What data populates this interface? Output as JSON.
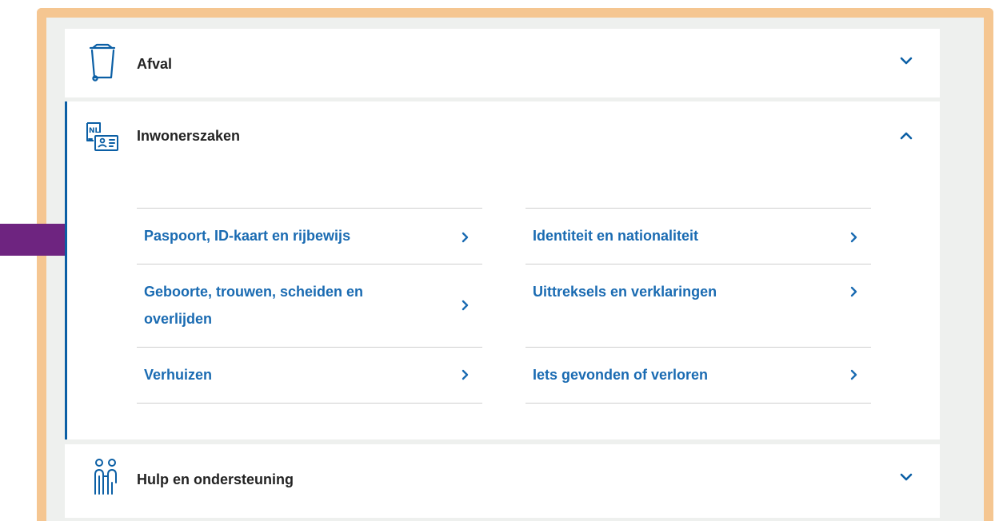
{
  "colors": {
    "accent_blue": "#0b5fa5",
    "link_blue": "#1a6bb2",
    "frame_orange": "#f5c691",
    "annotation_arrow": "#6e2480"
  },
  "sections": [
    {
      "title": "Afval",
      "icon": "wheelie-bin-icon",
      "expanded": false
    },
    {
      "title": "Inwonerszaken",
      "icon": "nl-id-card-icon",
      "expanded": true
    },
    {
      "title": "Hulp en ondersteuning",
      "icon": "people-support-icon",
      "expanded": false
    }
  ],
  "inwonerszaken_links": {
    "left": [
      "Paspoort, ID-kaart en rijbewijs",
      "Geboorte, trouwen, scheiden en overlijden",
      "Verhuizen"
    ],
    "right": [
      "Identiteit en nationaliteit",
      "Uittreksels en verklaringen",
      "Iets gevonden of verloren"
    ]
  },
  "annotation": {
    "type": "arrow",
    "points_to": "Paspoort, ID-kaart en rijbewijs"
  }
}
